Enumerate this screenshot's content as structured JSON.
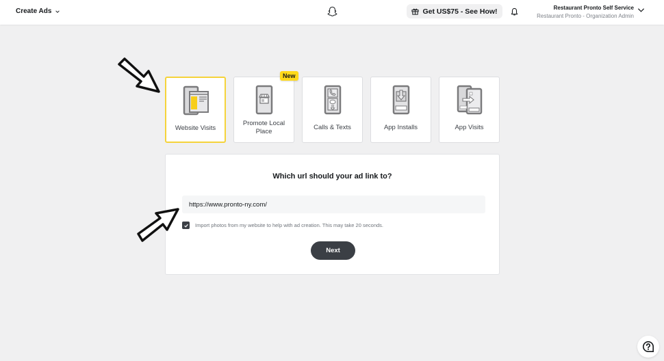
{
  "header": {
    "menu_label": "Create Ads",
    "logo": "snapchat-ghost-icon",
    "promo_label": "Get US$75 - See How!",
    "promo_icon": "gift-icon",
    "notifications_icon": "bell-icon",
    "account": {
      "name": "Restaurant Pronto Self Service",
      "role": "Restaurant Pronto - Organization Admin"
    }
  },
  "objectives": {
    "badge": "New",
    "items": [
      {
        "label": "Website Visits",
        "icon": "website-visits-icon",
        "selected": true
      },
      {
        "label": "Promote Local Place",
        "icon": "local-place-icon",
        "selected": false,
        "badge": "New"
      },
      {
        "label": "Calls & Texts",
        "icon": "calls-texts-icon",
        "selected": false
      },
      {
        "label": "App Installs",
        "icon": "app-installs-icon",
        "selected": false
      },
      {
        "label": "App Visits",
        "icon": "app-visits-icon",
        "selected": false
      }
    ]
  },
  "url_form": {
    "question": "Which url should your ad link to?",
    "url_value": "https://www.pronto-ny.com/",
    "import_photos_checked": true,
    "import_photos_label": "Import photos from my website to help with ad creation. This may take 20 seconds.",
    "next_label": "Next"
  },
  "help_icon": "help-chat-icon",
  "colors": {
    "accent_yellow": "#f5d33a",
    "badge_yellow": "#ffd91a",
    "button_dark": "#3b3f45",
    "background": "#f0f0f1"
  }
}
